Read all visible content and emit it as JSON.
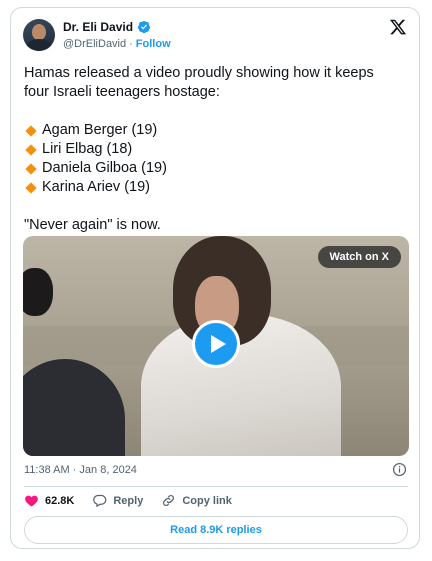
{
  "author": {
    "name": "Dr. Eli David",
    "handle": "@DrEliDavid",
    "separator": "·",
    "follow_label": "Follow"
  },
  "tweet": {
    "line1": "Hamas released a video proudly showing how it keeps",
    "line2": "four Israeli teenagers hostage:",
    "names": [
      "Agam Berger (19)",
      "Liri Elbag (18)",
      "Daniela Gilboa (19)",
      "Karina Ariev (19)"
    ],
    "closing": "\"Never again\" is now."
  },
  "media": {
    "watch_label": "Watch on X"
  },
  "meta": {
    "timestamp": "11:38 AM · Jan 8, 2024"
  },
  "actions": {
    "likes": "62.8K",
    "reply_label": "Reply",
    "copy_label": "Copy link",
    "read_replies": "Read 8.9K replies"
  },
  "colors": {
    "accent": "#1d9bf0",
    "like": "#f91880",
    "bullet": "#f4900c"
  },
  "icons": [
    "verified-badge-icon",
    "x-logo-icon",
    "play-icon",
    "info-icon",
    "heart-icon",
    "reply-icon",
    "link-icon"
  ]
}
